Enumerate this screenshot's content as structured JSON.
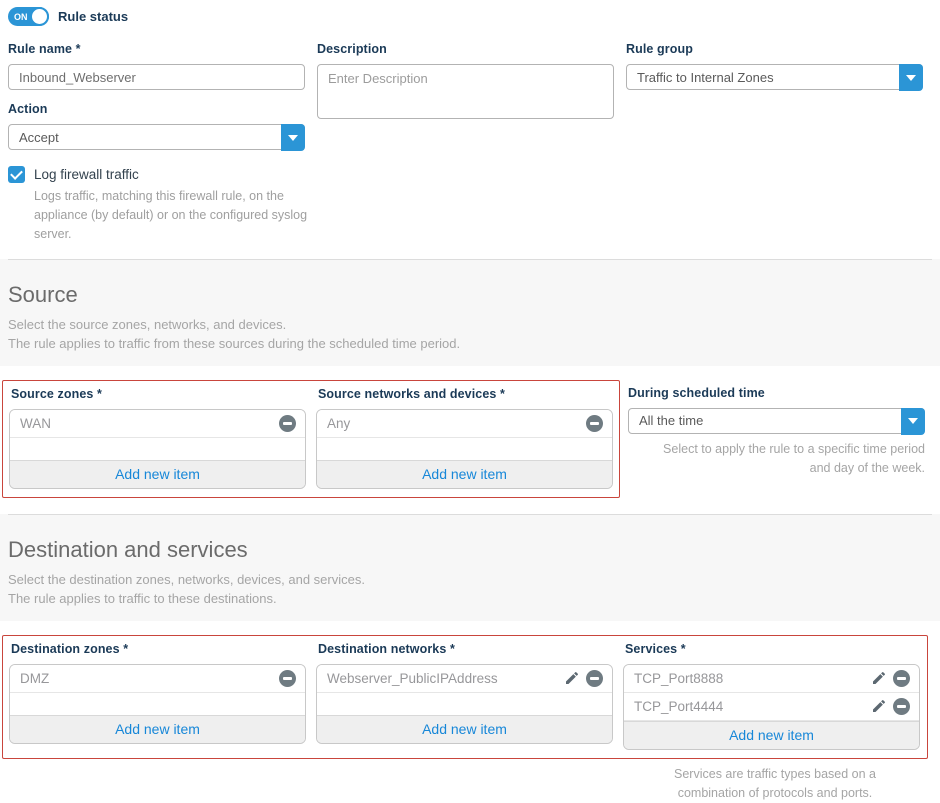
{
  "colors": {
    "accent_blue": "#2b95d6",
    "link_blue": "#1787d8",
    "error_red": "#c9453c",
    "label_navy": "#1b3a57"
  },
  "rule_status": {
    "toggle_state": "ON",
    "label": "Rule status"
  },
  "fields": {
    "rule_name": {
      "label": "Rule name *",
      "value": "Inbound_Webserver"
    },
    "description": {
      "label": "Description",
      "placeholder": "Enter Description"
    },
    "rule_group": {
      "label": "Rule group",
      "value": "Traffic to Internal Zones"
    },
    "action": {
      "label": "Action",
      "value": "Accept"
    },
    "log_traffic": {
      "label": "Log firewall traffic",
      "checked": true,
      "help": "Logs traffic, matching this firewall rule, on the appliance (by default) or on the configured syslog server."
    }
  },
  "source_section": {
    "title": "Source",
    "subtitle_1": "Select the source zones, networks, and devices.",
    "subtitle_2": "The rule applies to traffic from these sources during the scheduled time period.",
    "source_zones": {
      "label": "Source zones *",
      "items": [
        "WAN"
      ],
      "add_label": "Add new item"
    },
    "source_networks": {
      "label": "Source networks and devices *",
      "items": [
        "Any"
      ],
      "add_label": "Add new item"
    },
    "schedule": {
      "label": "During scheduled time",
      "value": "All the time",
      "help_line1": "Select to apply the rule to a specific time period",
      "help_line2": "and day of the week."
    }
  },
  "destination_section": {
    "title": "Destination and services",
    "subtitle_1": "Select the destination zones, networks, devices, and services.",
    "subtitle_2": "The rule applies to traffic to these destinations.",
    "destination_zones": {
      "label": "Destination zones *",
      "items": [
        "DMZ"
      ],
      "add_label": "Add new item"
    },
    "destination_networks": {
      "label": "Destination networks *",
      "items": [
        "Webserver_PublicIPAddress"
      ],
      "add_label": "Add new item"
    },
    "services": {
      "label": "Services *",
      "items": [
        "TCP_Port8888",
        "TCP_Port4444"
      ],
      "add_label": "Add new item",
      "help_line1": "Services are traffic types based on a",
      "help_line2": "combination of protocols and ports."
    }
  }
}
